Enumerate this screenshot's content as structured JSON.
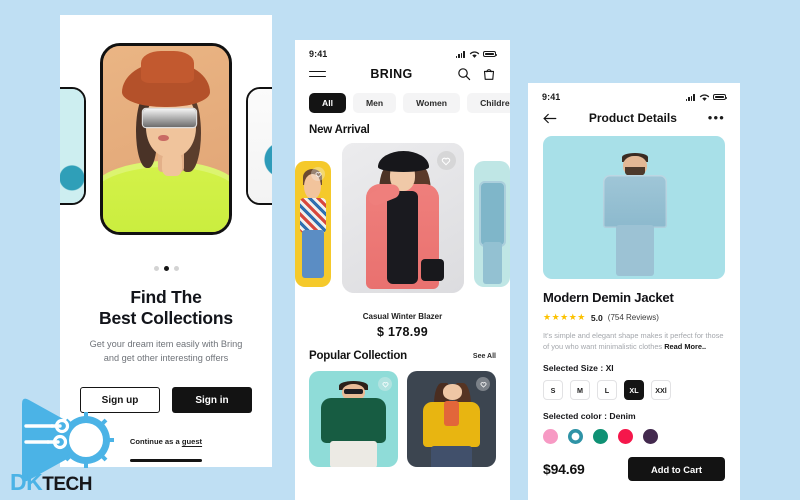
{
  "background_color": "#bfdff3",
  "watermark": {
    "brand_part1": "DK",
    "brand_part2": "TECH",
    "logo_icon": "dk-tech-circuit-gear-logo",
    "color": "#4bb3e6"
  },
  "screen1": {
    "name": "onboarding",
    "carousel": {
      "dots": 3,
      "active_index": 1
    },
    "title_line1": "Find The",
    "title_line2": "Best Collections",
    "subtitle_line1": "Get your dream item easily with Bring",
    "subtitle_line2": "and get other interesting offers",
    "signup_label": "Sign up",
    "signin_label": "Sign in",
    "guest_prefix": "Continue as a ",
    "guest_link": "guest"
  },
  "screen2": {
    "name": "home",
    "status": {
      "time": "9:41",
      "signal_icon": "signal-bars-icon",
      "wifi_icon": "wifi-icon",
      "battery_icon": "battery-icon"
    },
    "topbar": {
      "menu_icon": "hamburger-menu-icon",
      "brand": "BRING",
      "search_icon": "search-icon",
      "bag_icon": "shopping-bag-icon"
    },
    "chips": [
      {
        "label": "All",
        "active": true
      },
      {
        "label": "Men",
        "active": false
      },
      {
        "label": "Women",
        "active": false
      },
      {
        "label": "Children",
        "active": false
      }
    ],
    "new_arrival": {
      "section_title": "New Arrival",
      "favorite_icon": "heart-icon",
      "product_name": "Casual Winter Blazer",
      "product_price": "$ 178.99"
    },
    "popular": {
      "section_title": "Popular Collection",
      "see_all": "See All",
      "favorite_icon": "heart-icon"
    }
  },
  "screen3": {
    "name": "product-details",
    "status": {
      "time": "9:41",
      "signal_icon": "signal-bars-icon",
      "wifi_icon": "wifi-icon",
      "battery_icon": "battery-icon"
    },
    "nav": {
      "back_icon": "arrow-left-icon",
      "title": "Product Details",
      "more_icon": "more-options-icon",
      "more_glyph": "•••"
    },
    "product_name": "Modern Demin Jacket",
    "rating": {
      "stars": "★★★★★",
      "value": "5.0",
      "reviews": "(754 Reviews)",
      "star_color": "#fcc200"
    },
    "description": "It's simple and elegant shape makes it perfect for those of you who want minimalistic clothes",
    "read_more": "Read More..",
    "size_label": "Selected Size : Xl",
    "sizes": [
      {
        "label": "S",
        "active": false
      },
      {
        "label": "M",
        "active": false
      },
      {
        "label": "L",
        "active": false
      },
      {
        "label": "XL",
        "active": true
      },
      {
        "label": "XXl",
        "active": false
      }
    ],
    "color_label": "Selected color : Denim",
    "colors": [
      {
        "name": "pink",
        "hex": "#f79ac4",
        "selected": false
      },
      {
        "name": "denim",
        "hex": "#2f93a6",
        "selected": true
      },
      {
        "name": "teal",
        "hex": "#0f9174",
        "selected": false
      },
      {
        "name": "red",
        "hex": "#f5174b",
        "selected": false
      },
      {
        "name": "purple",
        "hex": "#43294e",
        "selected": false
      }
    ],
    "price": "$94.69",
    "cart_button": "Add to Cart"
  }
}
